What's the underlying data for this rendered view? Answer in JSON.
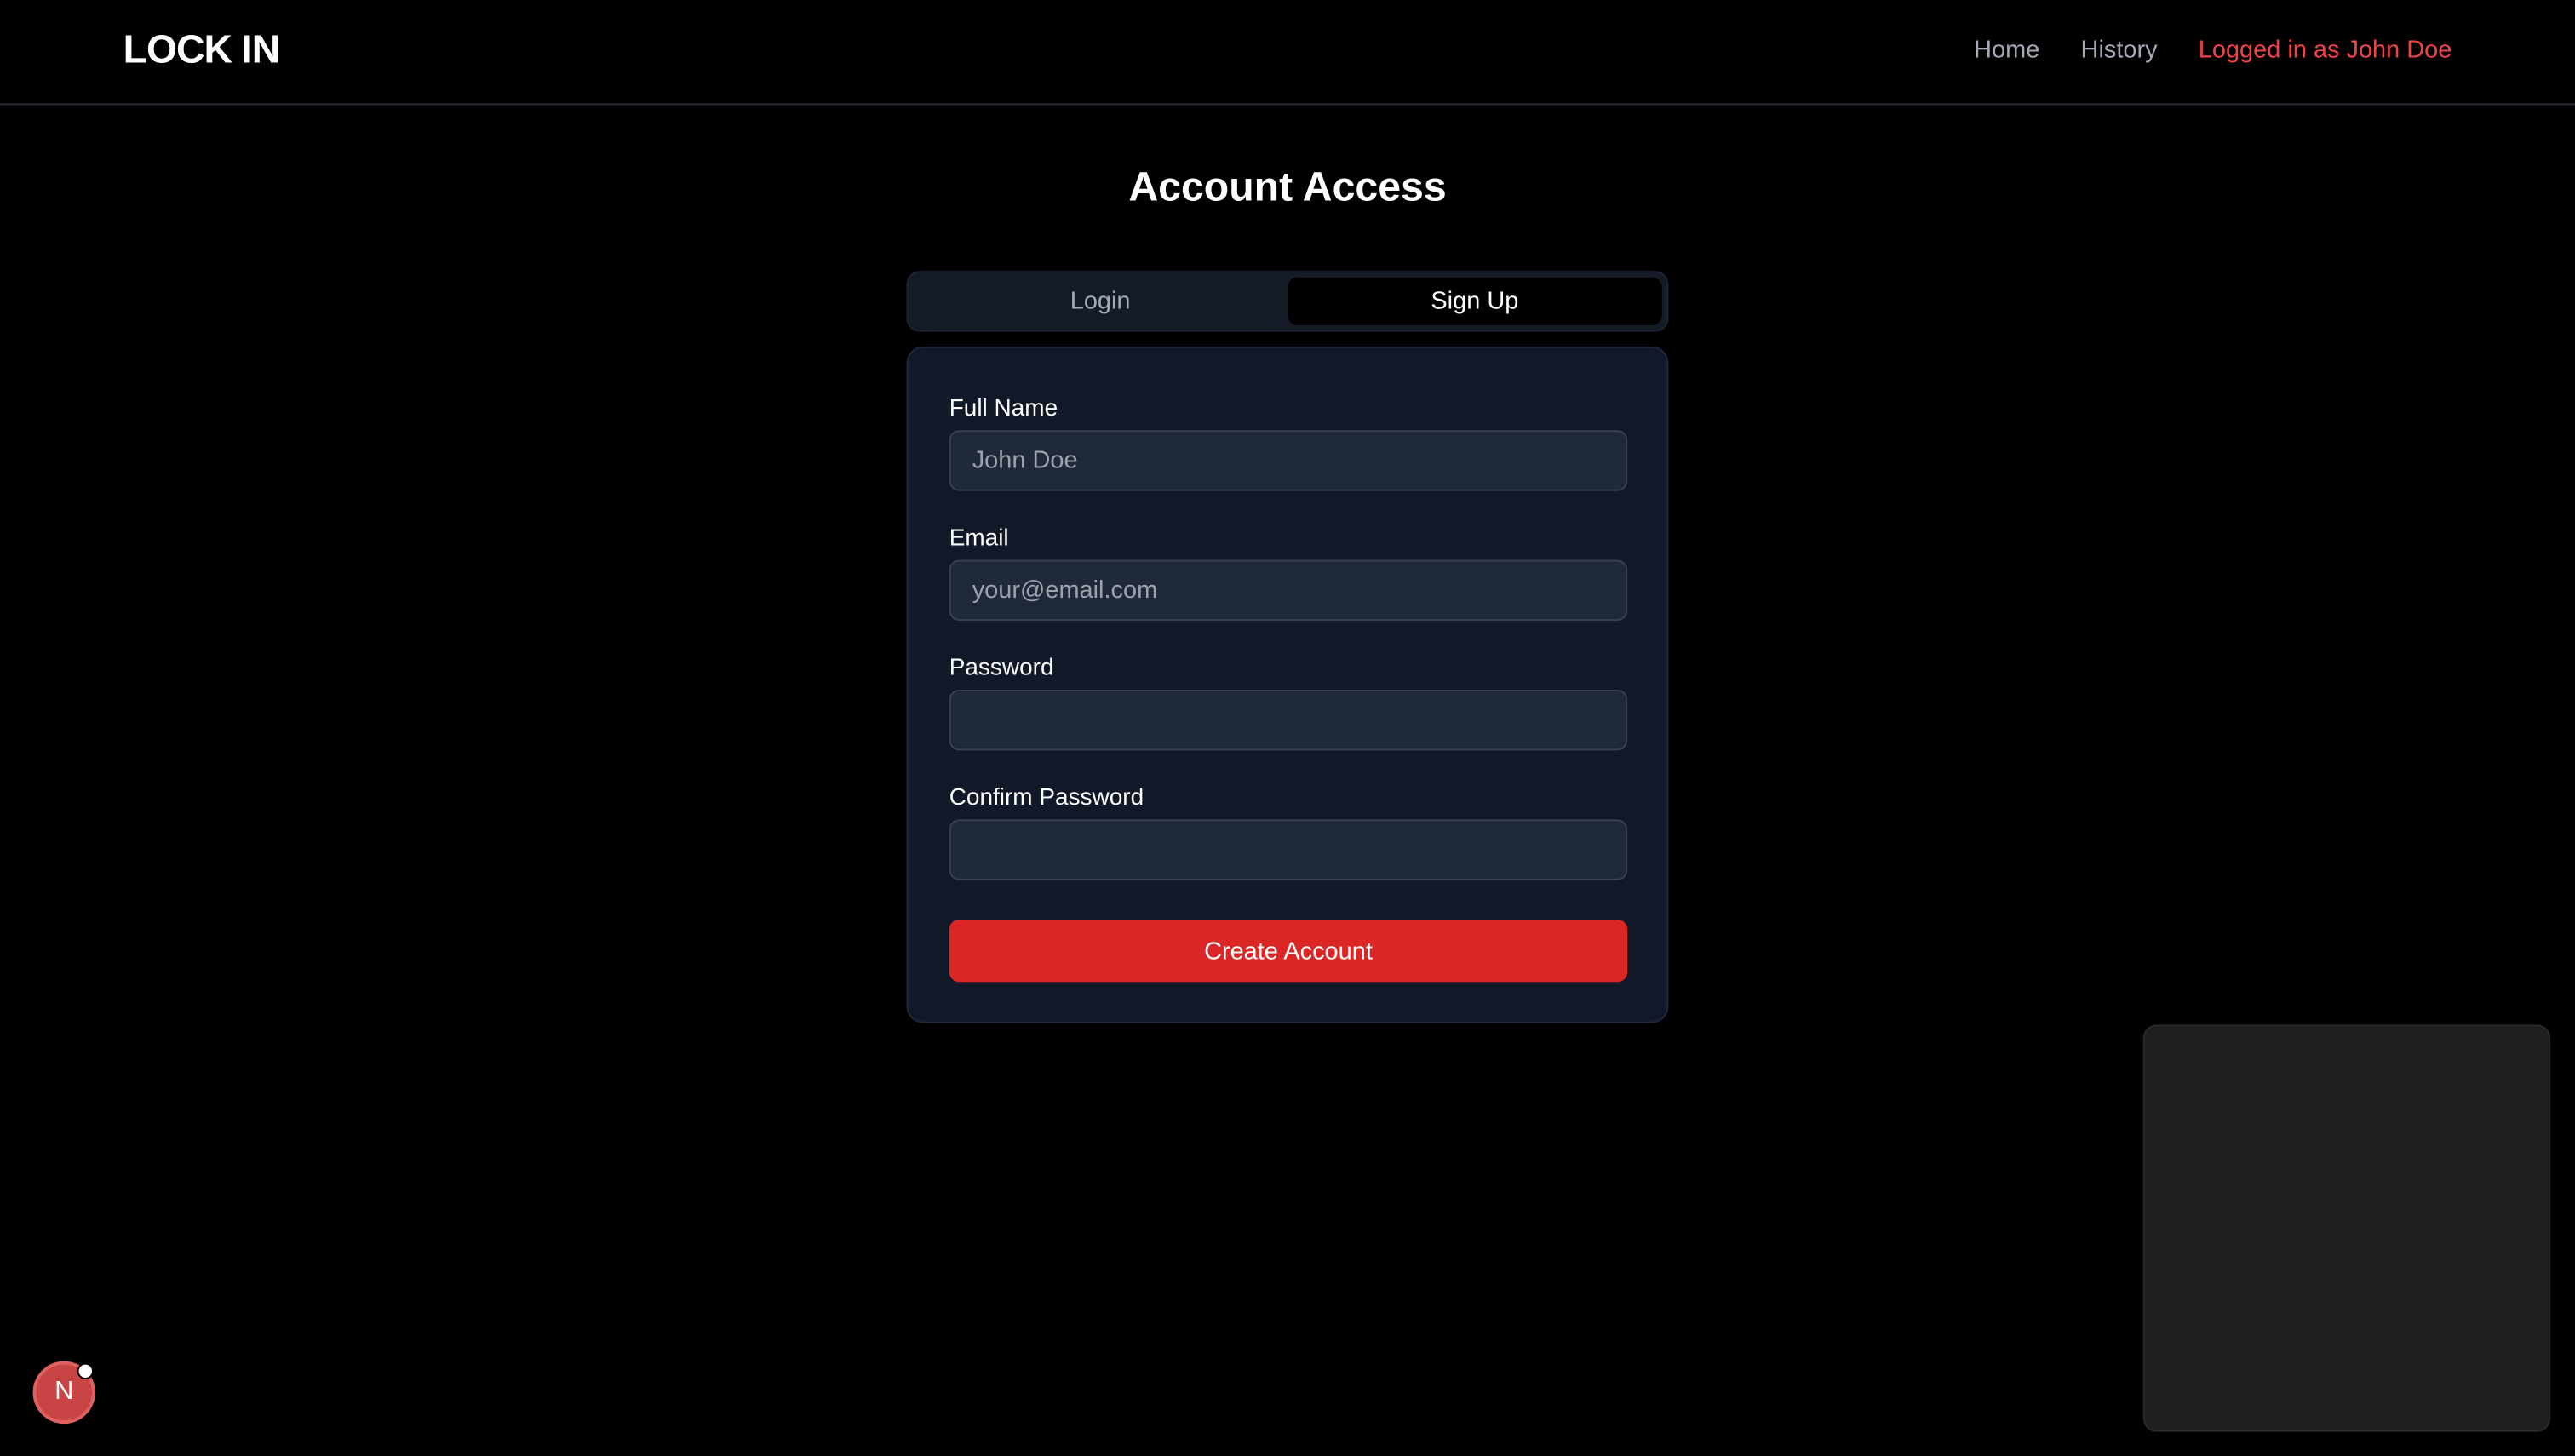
{
  "header": {
    "brand": "LOCK IN",
    "nav": {
      "home": "Home",
      "history": "History",
      "user_status": "Logged in as John Doe"
    }
  },
  "main": {
    "title": "Account Access",
    "tabs": {
      "login": "Login",
      "signup": "Sign Up",
      "active": "Sign Up"
    },
    "form": {
      "full_name_label": "Full Name",
      "full_name_placeholder": "John Doe",
      "email_label": "Email",
      "email_placeholder": "your@email.com",
      "password_label": "Password",
      "password_placeholder": "",
      "confirm_password_label": "Confirm Password",
      "confirm_password_placeholder": "",
      "submit_label": "Create Account"
    }
  },
  "dev_badge": {
    "letter": "N"
  },
  "colors": {
    "accent": "#dc2626",
    "user_status": "#ef4444",
    "card_bg": "#111827",
    "input_bg": "#1f2937"
  }
}
